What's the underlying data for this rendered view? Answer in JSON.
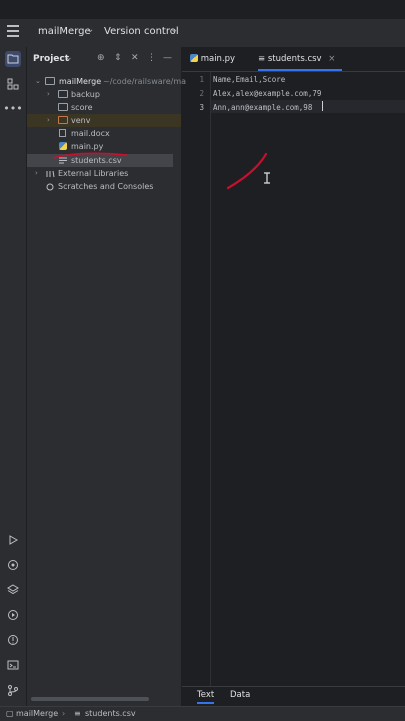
{
  "titlebar": {
    "project_name": "mailMerge",
    "vcs_label": "Version control"
  },
  "project_panel": {
    "title": "Project",
    "tree": {
      "root": {
        "label": "mailMerge",
        "path": "~/code/railsware/ma"
      },
      "items": [
        {
          "label": "backup",
          "type": "folder"
        },
        {
          "label": "score",
          "type": "folder"
        },
        {
          "label": "venv",
          "type": "folder-excluded"
        },
        {
          "label": "mail.docx",
          "type": "file"
        },
        {
          "label": "main.py",
          "type": "python"
        },
        {
          "label": "students.csv",
          "type": "text"
        }
      ],
      "external_libraries": "External Libraries",
      "scratches": "Scratches and Consoles"
    }
  },
  "editor": {
    "tabs": [
      {
        "label": "main.py",
        "icon": "python-icon",
        "active": false
      },
      {
        "label": "students.csv",
        "icon": "text-file-icon",
        "active": true
      }
    ],
    "lines": [
      {
        "number": "1",
        "text": "Name,Email,Score"
      },
      {
        "number": "2",
        "text": "Alex,alex@example.com,79"
      },
      {
        "number": "3",
        "text": "Ann,ann@example.com,98"
      }
    ],
    "bottom_tabs": [
      {
        "label": "Text",
        "active": true
      },
      {
        "label": "Data",
        "active": false
      }
    ]
  },
  "statusbar": {
    "breadcrumb": [
      "mailMerge",
      "students.csv"
    ]
  },
  "colors": {
    "accent": "#3574f0",
    "annotation_red": "#c8102e",
    "selection": "#43454a"
  }
}
